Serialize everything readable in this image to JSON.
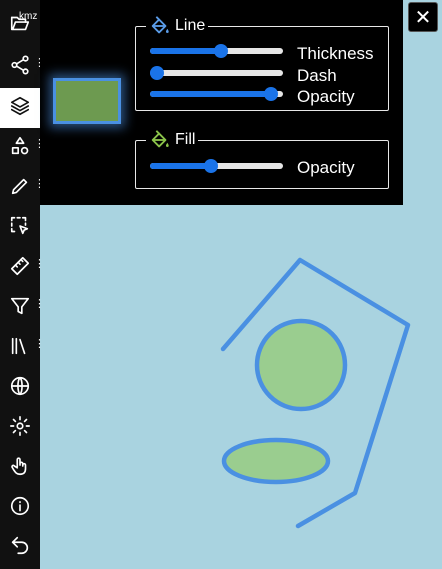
{
  "toolbar": {
    "items": [
      {
        "name": "open-file",
        "icon": "folder-open-icon",
        "badge": "kmz",
        "has_menu": false
      },
      {
        "name": "share",
        "icon": "share-icon",
        "has_menu": true
      },
      {
        "name": "layers",
        "icon": "layers-icon",
        "has_menu": false,
        "active": true
      },
      {
        "name": "shapes",
        "icon": "shapes-icon",
        "has_menu": true
      },
      {
        "name": "draw",
        "icon": "pencil-icon",
        "has_menu": true
      },
      {
        "name": "select",
        "icon": "select-area-icon",
        "has_menu": false
      },
      {
        "name": "measure",
        "icon": "ruler-icon",
        "has_menu": true
      },
      {
        "name": "filter",
        "icon": "filter-icon",
        "has_menu": true
      },
      {
        "name": "library",
        "icon": "library-icon",
        "has_menu": true
      },
      {
        "name": "globe",
        "icon": "globe-icon",
        "has_menu": false
      },
      {
        "name": "settings",
        "icon": "gear-icon",
        "has_menu": false
      },
      {
        "name": "pan",
        "icon": "hand-pointer-icon",
        "has_menu": false
      },
      {
        "name": "info",
        "icon": "info-icon",
        "has_menu": false
      },
      {
        "name": "undo",
        "icon": "undo-icon",
        "has_menu": false
      }
    ],
    "menu_glyph": "⋮"
  },
  "style_panel": {
    "line": {
      "title": "Line",
      "icon": "line-paint-bucket-icon",
      "sliders": [
        {
          "label": "Thickness",
          "value": 0.54
        },
        {
          "label": "Dash",
          "value": 0.0
        },
        {
          "label": "Opacity",
          "value": 0.96
        }
      ]
    },
    "fill": {
      "title": "Fill",
      "icon": "fill-paint-bucket-icon",
      "sliders": [
        {
          "label": "Opacity",
          "value": 0.45
        }
      ]
    },
    "preview": {
      "fill_color": "#6d9a50",
      "line_color": "#4a90e2"
    }
  },
  "close_button": {
    "label": "✕"
  },
  "colors": {
    "map_background": "#a9d3e0",
    "shape_fill": "#9acd8f",
    "shape_stroke": "#4a90e2",
    "slider_accent": "#1a73e8"
  }
}
